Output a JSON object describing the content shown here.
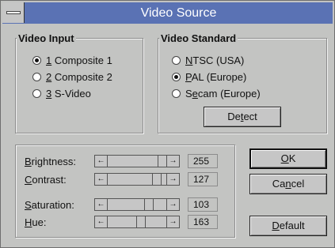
{
  "window": {
    "title": "Video Source"
  },
  "video_input": {
    "label": "Video Input",
    "options": [
      {
        "num": "1",
        "text": " Composite 1",
        "selected": true
      },
      {
        "num": "2",
        "text": " Composite 2",
        "selected": false
      },
      {
        "num": "3",
        "text": " S-Video",
        "selected": false
      }
    ]
  },
  "video_standard": {
    "label": "Video Standard",
    "options": [
      {
        "acc": "N",
        "rest": "TSC (USA)",
        "selected": false
      },
      {
        "acc": "P",
        "rest": "AL (Europe)",
        "selected": true
      },
      {
        "pre": "S",
        "acc": "e",
        "rest": "cam (Europe)",
        "selected": false
      }
    ],
    "detect": {
      "pre": "De",
      "acc": "t",
      "rest": "ect"
    }
  },
  "adjustments": {
    "brightness": {
      "acc": "B",
      "rest": "rightness:",
      "value": "255"
    },
    "contrast": {
      "acc": "C",
      "rest": "ontrast:",
      "value": "127"
    },
    "saturation": {
      "acc": "S",
      "rest": "aturation:",
      "value": "103"
    },
    "hue": {
      "acc": "H",
      "rest": "ue:",
      "value": "163"
    }
  },
  "buttons": {
    "ok": {
      "acc": "O",
      "rest": "K"
    },
    "cancel": {
      "pre": "Ca",
      "acc": "n",
      "rest": "cel"
    },
    "default": {
      "acc": "D",
      "rest": "efault"
    }
  },
  "icons": {
    "left_arrow": "←",
    "right_arrow": "→"
  }
}
